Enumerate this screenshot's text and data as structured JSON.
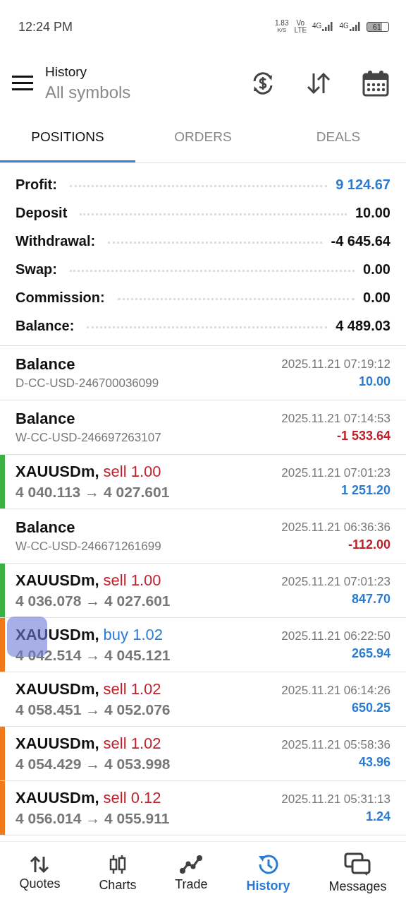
{
  "status_bar": {
    "time": "12:24 PM",
    "speed": "1.83",
    "speed_unit": "K/S",
    "volte_top": "Vo",
    "volte_bottom": "LTE",
    "sim1": "4G",
    "sim2": "4G",
    "battery": "61"
  },
  "header": {
    "title": "History",
    "subtitle": "All symbols"
  },
  "tabs": [
    {
      "label": "POSITIONS",
      "selected": true
    },
    {
      "label": "ORDERS",
      "selected": false
    },
    {
      "label": "DEALS",
      "selected": false
    }
  ],
  "summary": [
    {
      "label": "Profit:",
      "value": "9 124.67",
      "highlight": true
    },
    {
      "label": "Deposit",
      "value": "10.00",
      "highlight": false
    },
    {
      "label": "Withdrawal:",
      "value": "-4 645.64",
      "highlight": false
    },
    {
      "label": "Swap:",
      "value": "0.00",
      "highlight": false
    },
    {
      "label": "Commission:",
      "value": "0.00",
      "highlight": false
    },
    {
      "label": "Balance:",
      "value": "4 489.03",
      "highlight": false
    }
  ],
  "entries": [
    {
      "kind": "balance",
      "title": "Balance",
      "detail": "D-CC-USD-246700036099",
      "time": "2025.11.21 07:19:12",
      "amount": "10.00",
      "negative": false
    },
    {
      "kind": "balance",
      "title": "Balance",
      "detail": "W-CC-USD-246697263107",
      "time": "2025.11.21 07:14:53",
      "amount": "-1 533.64",
      "negative": true
    },
    {
      "kind": "trade",
      "title": "XAUUSDm,",
      "order": "sell 1.00",
      "is_buy": false,
      "detail": "4 040.113 → 4 027.601",
      "time": "2025.11.21 07:01:23",
      "amount": "1 251.20",
      "negative": false,
      "color": "#3cb043"
    },
    {
      "kind": "balance",
      "title": "Balance",
      "detail": "W-CC-USD-246671261699",
      "time": "2025.11.21 06:36:36",
      "amount": "-112.00",
      "negative": true
    },
    {
      "kind": "trade",
      "title": "XAUUSDm,",
      "order": "sell 1.00",
      "is_buy": false,
      "detail": "4 036.078 → 4 027.601",
      "time": "2025.11.21 07:01:23",
      "amount": "847.70",
      "negative": false,
      "color": "#3cb043"
    },
    {
      "kind": "trade",
      "title": "XAUUSDm,",
      "order": "buy 1.02",
      "is_buy": true,
      "detail": "4 042.514 → 4 045.121",
      "time": "2025.11.21 06:22:50",
      "amount": "265.94",
      "negative": false,
      "color": "#f07a1a"
    },
    {
      "kind": "trade",
      "title": "XAUUSDm,",
      "order": "sell 1.02",
      "is_buy": false,
      "detail": "4 058.451 → 4 052.076",
      "time": "2025.11.21 06:14:26",
      "amount": "650.25",
      "negative": false
    },
    {
      "kind": "trade",
      "title": "XAUUSDm,",
      "order": "sell 1.02",
      "is_buy": false,
      "detail": "4 054.429 → 4 053.998",
      "time": "2025.11.21 05:58:36",
      "amount": "43.96",
      "negative": false,
      "color": "#f07a1a"
    },
    {
      "kind": "trade",
      "title": "XAUUSDm,",
      "order": "sell 0.12",
      "is_buy": false,
      "detail": "4 056.014 → 4 055.911",
      "time": "2025.11.21 05:31:13",
      "amount": "1.24",
      "negative": false,
      "color": "#f07a1a"
    }
  ],
  "bottom_nav": [
    {
      "label": "Quotes",
      "selected": false
    },
    {
      "label": "Charts",
      "selected": false
    },
    {
      "label": "Trade",
      "selected": false
    },
    {
      "label": "History",
      "selected": true
    },
    {
      "label": "Messages",
      "selected": false
    }
  ]
}
